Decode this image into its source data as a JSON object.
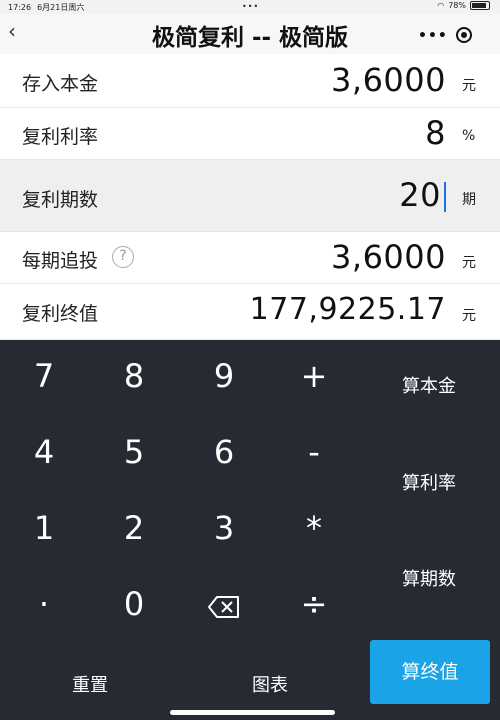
{
  "status_bar": {
    "time": "17:26",
    "date": "6月21日周六",
    "battery": "78%",
    "battery_level": 0.78
  },
  "nav": {
    "title": "极简复利 -- 极简版",
    "back_icon": "chevron-left-icon",
    "more_icon": "more-dots-icon",
    "close_icon": "target-icon"
  },
  "rows": [
    {
      "label": "存入本金",
      "value": "3,6000",
      "unit": "元"
    },
    {
      "label": "复利利率",
      "value": "8",
      "unit": "%"
    },
    {
      "label": "复利期数",
      "value": "20",
      "unit": "期",
      "active": true
    },
    {
      "label": "每期追投",
      "value": "3,6000",
      "unit": "元",
      "help": "?"
    },
    {
      "label": "复利终值",
      "value": "177,9225.17",
      "unit": "元"
    }
  ],
  "keypad": {
    "keys": [
      "7",
      "8",
      "9",
      "+",
      "4",
      "5",
      "6",
      "-",
      "1",
      "2",
      "3",
      "*",
      "·",
      "0",
      "⌫",
      "÷"
    ],
    "actions": [
      "算本金",
      "算利率",
      "算期数",
      "算终值"
    ],
    "bottom": [
      "重置",
      "图表"
    ]
  },
  "colors": {
    "keypad_bg": "#262b33",
    "accent": "#1aa3e6",
    "caret": "#1a73e8"
  }
}
